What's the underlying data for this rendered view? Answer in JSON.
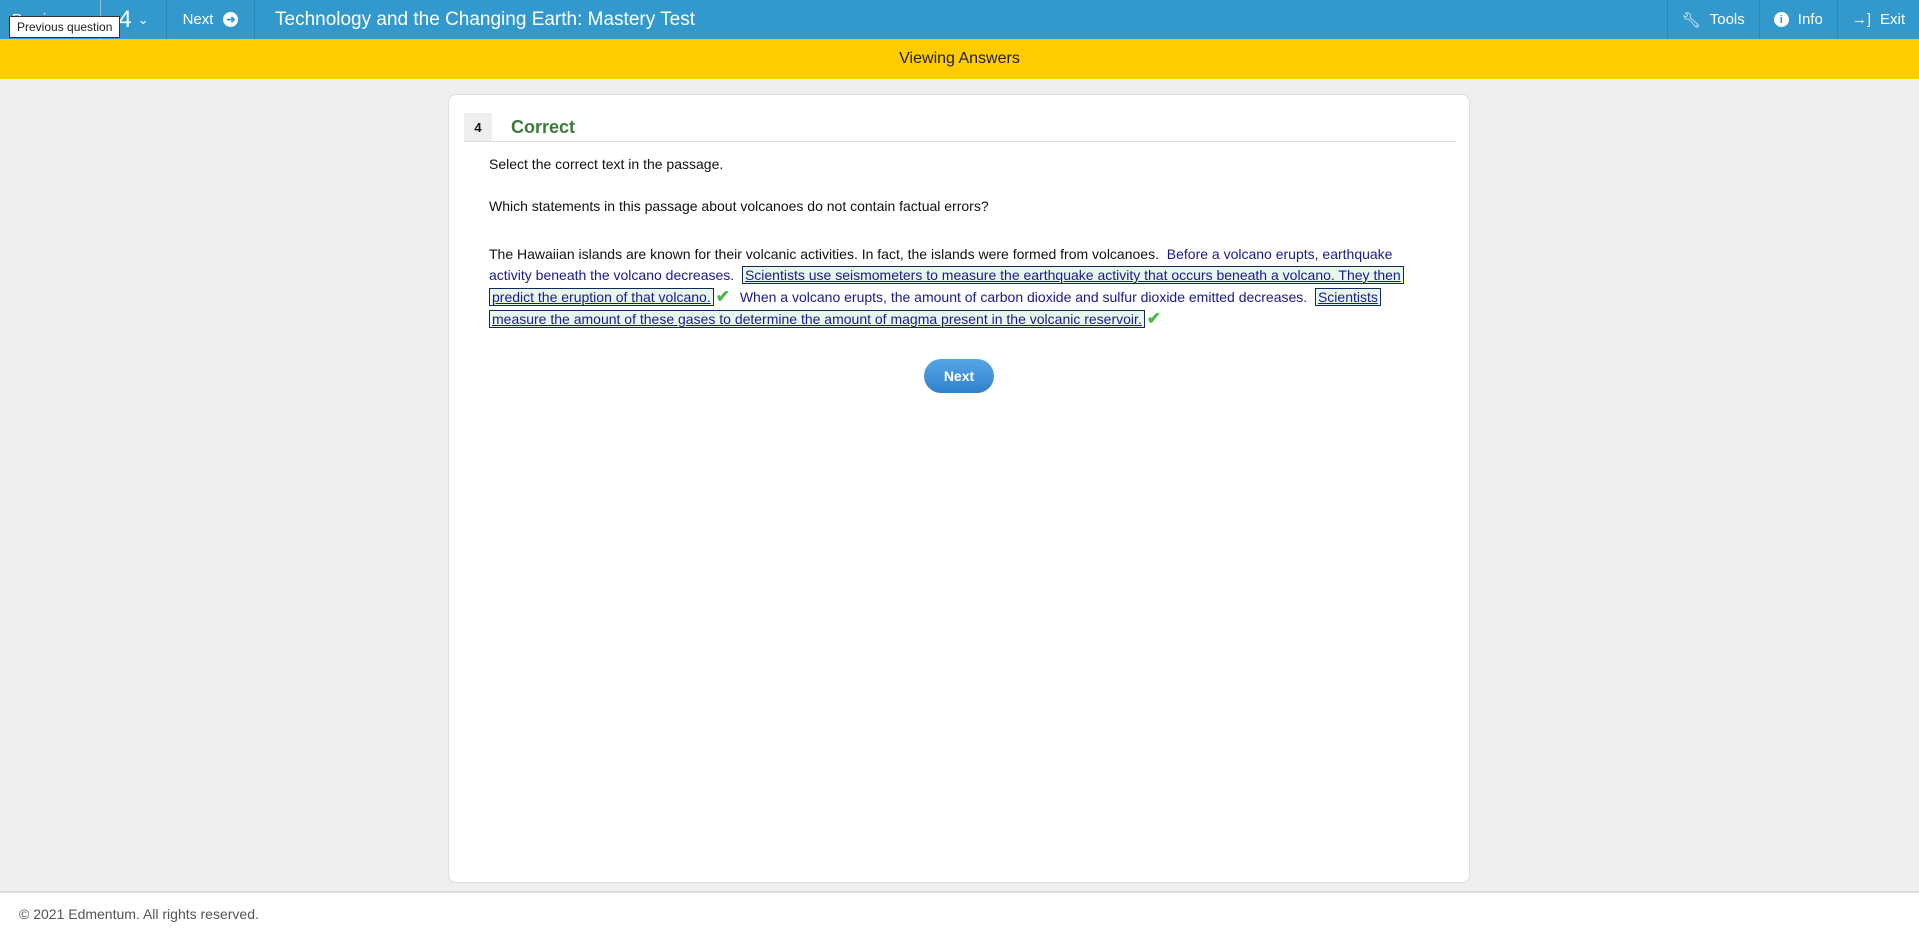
{
  "topbar": {
    "previous_label": "Previous",
    "question_number": "4",
    "next_label": "Next",
    "title": "Technology and the Changing Earth: Mastery Test",
    "tools_label": "Tools",
    "info_label": "Info",
    "exit_label": "Exit"
  },
  "tooltip": "Previous question",
  "banner": "Viewing Answers",
  "question": {
    "number": "4",
    "status": "Correct",
    "instruction": "Select the correct text in the passage.",
    "prompt": "Which statements in this passage about volcanoes do not contain factual errors?",
    "passage": [
      {
        "text": "The Hawaiian islands are known for their volcanic activities. In fact, the islands were formed from volcanoes.",
        "type": "plain"
      },
      {
        "text": "Before a volcano erupts, earthquake activity beneath the volcano decreases.",
        "type": "option"
      },
      {
        "text": "Scientists use seismometers to measure the earthquake activity that occurs beneath a volcano. They then predict the eruption of that volcano.",
        "type": "selected-correct"
      },
      {
        "text": "When a volcano erupts, the amount of carbon dioxide and sulfur dioxide emitted decreases.",
        "type": "option"
      },
      {
        "text": "Scientists measure the amount of these gases to determine the amount of magma present in the volcanic reservoir.",
        "type": "selected-correct"
      }
    ],
    "next_button": "Next"
  },
  "footer": "© 2021 Edmentum. All rights reserved.",
  "colors": {
    "topbar": "#3399cc",
    "banner": "#ffcc00",
    "correct": "#3a7a3a",
    "check": "#4cb84c"
  }
}
